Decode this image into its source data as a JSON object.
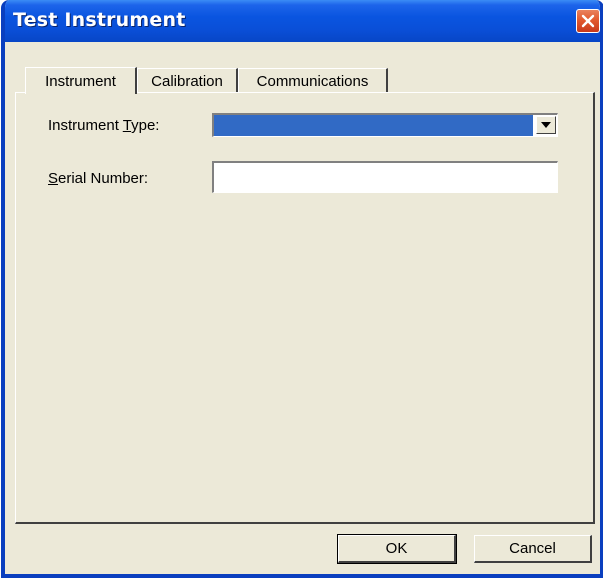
{
  "window": {
    "title": "Test Instrument"
  },
  "tabs": [
    {
      "label": "Instrument",
      "selected": true
    },
    {
      "label": "Calibration",
      "selected": false
    },
    {
      "label": "Communications",
      "selected": false
    }
  ],
  "form": {
    "instrument_type": {
      "label_before": "Instrument ",
      "label_mnemonic": "T",
      "label_after": "ype:",
      "value": ""
    },
    "serial_number": {
      "label_mnemonic": "S",
      "label_after": "erial Number:",
      "value": ""
    }
  },
  "buttons": {
    "ok_label": "OK",
    "cancel_label": "Cancel"
  },
  "colors": {
    "title_bar": "#0a55e0",
    "selection": "#316ac5",
    "dialog_face": "#ece9d8",
    "close_button": "#e25a2f"
  },
  "icons": {
    "close": "close-icon",
    "dropdown": "chevron-down-icon"
  }
}
